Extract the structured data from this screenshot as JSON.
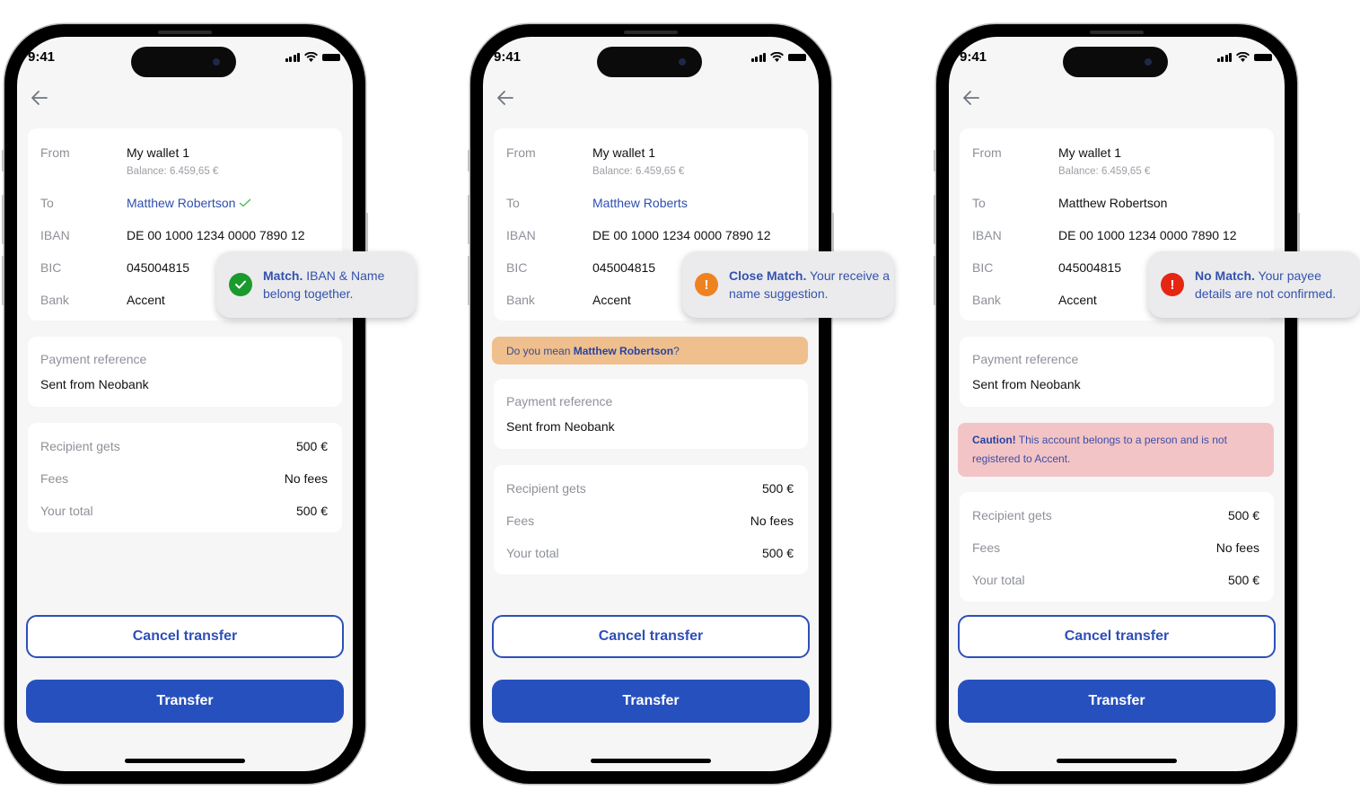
{
  "status_bar": {
    "time": "9:41"
  },
  "common": {
    "from_label": "From",
    "from_value": "My wallet 1",
    "balance": "Balance: 6.459,65 €",
    "to_label": "To",
    "iban_label": "IBAN",
    "iban_value": "DE 00 1000 1234 0000 7890 12",
    "bic_label": "BIC",
    "bic_value": "045004815",
    "bank_label": "Bank",
    "bank_value": "Accent",
    "reference_label": "Payment reference",
    "reference_value": "Sent from Neobank",
    "recipient_gets_label": "Recipient gets",
    "recipient_gets_value": "500 €",
    "fees_label": "Fees",
    "fees_value": "No fees",
    "total_label": "Your total",
    "total_value": "500 €",
    "cancel_label": "Cancel transfer",
    "transfer_label": "Transfer"
  },
  "screens": [
    {
      "state": "match",
      "to_value": "Matthew Robertson",
      "to_icon": "check-icon",
      "toast_title": "Match.",
      "toast_text": " IBAN & Name belong together.",
      "toast_icon": "check-circle-icon",
      "toast_color": "#1a9a2e"
    },
    {
      "state": "close-match",
      "to_value": "Matthew Roberts",
      "toast_title": "Close Match.",
      "toast_text": " Your receive a name suggestion.",
      "toast_icon": "exclamation-circle-icon",
      "toast_color": "#ef8220",
      "suggestion_prefix": "Do you mean ",
      "suggestion_name": "Matthew Robertson",
      "suggestion_suffix": "?"
    },
    {
      "state": "no-match",
      "to_value": "Matthew Robertson",
      "toast_title": "No Match.",
      "toast_text": " Your payee details are not confirmed.",
      "toast_icon": "exclamation-circle-icon",
      "toast_color": "#e52613",
      "caution_title": "Caution!",
      "caution_text": " This account belongs to a person and is not registered to Accent."
    }
  ]
}
